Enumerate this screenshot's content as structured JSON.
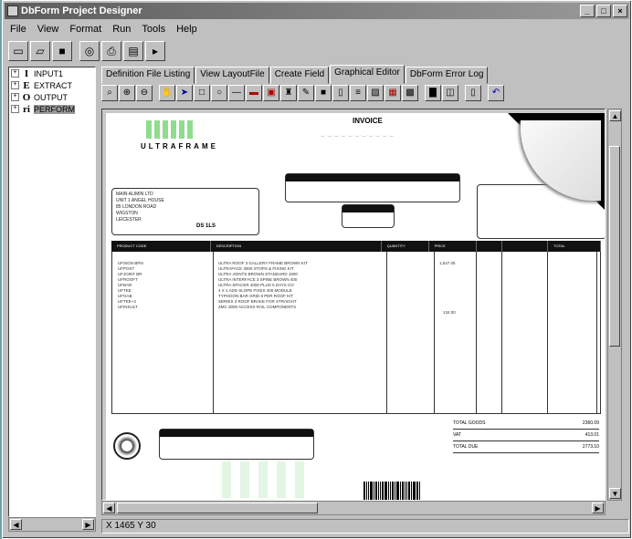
{
  "window": {
    "title": "DbForm Project Designer",
    "buttons": [
      "_",
      "□",
      "×"
    ]
  },
  "menu": [
    "File",
    "View",
    "Format",
    "Run",
    "Tools",
    "Help"
  ],
  "tree": [
    {
      "icon": "I",
      "label": "INPUT1"
    },
    {
      "icon": "E",
      "label": "EXTRACT"
    },
    {
      "icon": "O",
      "label": "OUTPUT"
    },
    {
      "icon": "ri",
      "label": "PERFORM",
      "selected": true
    }
  ],
  "tabs": [
    "Definition File Listing",
    "View LayoutFile",
    "Create Field",
    "Graphical Editor",
    "DbForm Error Log"
  ],
  "active_tab": 3,
  "invoice": {
    "title": "INVOICE",
    "logo_text": "ULTRAFRAME",
    "postcode": "DS 1LS",
    "address_lines": [
      "MAIN ALIMIN LTD",
      "UNIT 1 ANGEL HOUSE",
      "85 LONDON ROAD",
      "WIGSTON",
      "LEICESTER"
    ],
    "columns": [
      "PRODUCT CODE",
      "DESCRIPTION",
      "QUANTITY",
      "PRICE",
      "",
      "",
      "TOTAL"
    ],
    "product_codes": [
      "UFSIGN BRN",
      "UFPOST",
      "UFJOINT BR",
      "UFROOFT",
      "UFBAR",
      "UFTEE",
      "UFGAB",
      "UFTEE+4",
      "UFINSULT"
    ],
    "descriptions": [
      "ULTRA ROOF 3 GALLERY FRAME BROWN KIT",
      "ULTRAFACE 3000 STOPS & FIXING KIT",
      "ULTRA JOINTS BROWN STANDARD 1500",
      "ULTRA INTERFACE 3 SPINE BROWN 400",
      "ULTRA SPACER 4000 PLUS 5 DAYS CO",
      "4 X 1 ADD SLOPE FIXES 400 MODULE",
      "TYPHOON BAR GRID 8 PER ROOF KIT",
      "SERIES 3 ROOF BRAKE FOR STRAIGHT",
      "ZMC 3000 ACCESS RAIL COMPONENTS"
    ],
    "price_top": "1,547.05",
    "price_mid": "134.00",
    "totals": [
      {
        "label": "TOTAL GOODS",
        "value": "2360.09"
      },
      {
        "label": "VAT",
        "value": "413.01"
      },
      {
        "label": "TOTAL DUE",
        "value": "2773.10"
      }
    ]
  },
  "status": {
    "coords": "X 1465 Y 30"
  }
}
